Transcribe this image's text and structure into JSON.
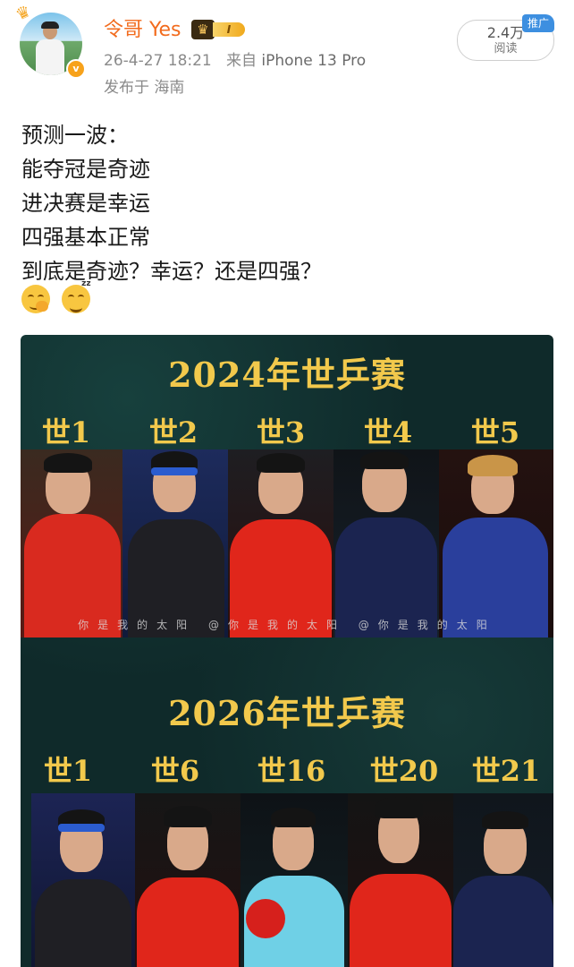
{
  "post": {
    "username": "令哥 Yes",
    "vip_level": "I",
    "timestamp": "26-4-27 18:21",
    "source_prefix": "来自",
    "device": "iPhone 13 Pro",
    "location": "发布于 海南",
    "reads_count": "2.4万",
    "reads_label": "阅读",
    "promo_tag": "推广",
    "verified_mark": "v"
  },
  "content": {
    "lines": [
      "预测一波：",
      "能夺冠是奇迹",
      "进决赛是幸运",
      "四强基本正常",
      "到底是奇迹？幸运？还是四强？"
    ],
    "emojis": [
      "thinking-face-emoji",
      "sleepy-grin-emoji"
    ]
  },
  "poster": {
    "title_2024": "2024年世乒赛",
    "title_2026": "2026年世乒赛",
    "ranks_2024": [
      "世1",
      "世2",
      "世3",
      "世4",
      "世5"
    ],
    "ranks_2026": [
      "世1",
      "世6",
      "世16",
      "世20",
      "世21"
    ],
    "caption": "你是我的太阳 @你是我的太阳 @你是我的太阳",
    "colors": {
      "background": "#0f2a2a",
      "title": "#f2c94c",
      "username": "#f26b1d",
      "promo": "#3d8fe0"
    }
  }
}
